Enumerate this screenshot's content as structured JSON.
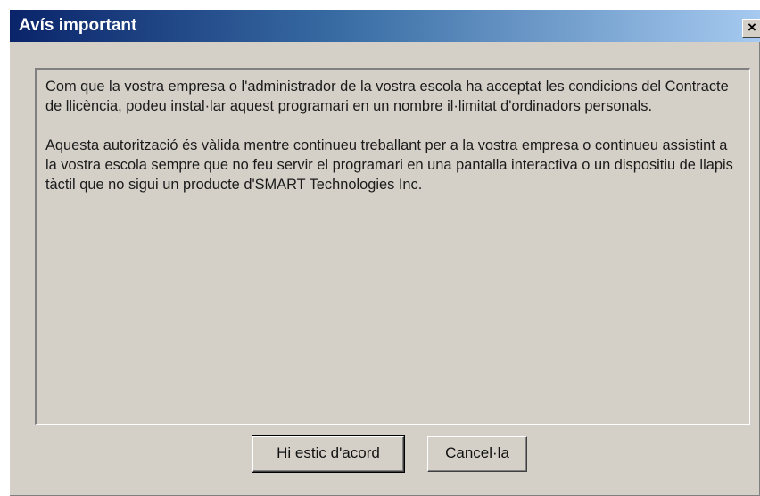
{
  "dialog": {
    "title": "Avís important",
    "close_label": "×",
    "paragraphs": [
      "Com que la vostra empresa o l'administrador de la vostra escola ha acceptat les condicions del Contracte de llicència, podeu instal·lar aquest programari en un nombre il·limitat d'ordinadors personals.",
      "Aquesta autorització és vàlida mentre continueu treballant per a la vostra empresa o continueu assistint a la vostra escola sempre que no feu servir el programari en una pantalla interactiva o un dispositiu de llapis tàctil que no sigui un producte d'SMART Technologies Inc."
    ],
    "buttons": {
      "accept_label": "Hi estic d'acord",
      "cancel_label": "Cancel·la"
    }
  },
  "colors": {
    "titlebar_start": "#0a246a",
    "titlebar_end": "#a6caf0",
    "dialog_face": "#d4d0c8"
  },
  "icons": {
    "close": "close-icon"
  }
}
